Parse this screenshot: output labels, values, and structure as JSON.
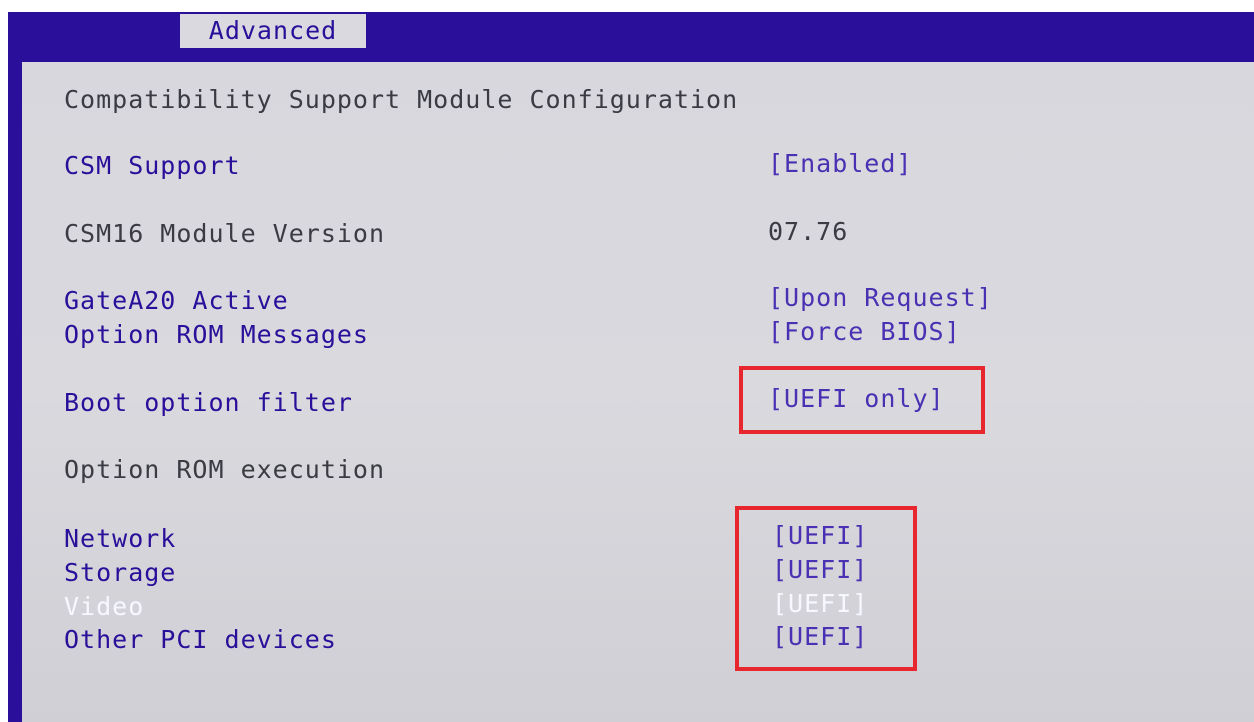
{
  "tabs": {
    "active": "Advanced"
  },
  "page": {
    "title": "Compatibility Support Module Configuration"
  },
  "settings": [
    {
      "label": "CSM Support",
      "value": "[Enabled]"
    },
    {
      "label": "CSM16 Module Version",
      "value": "07.76"
    },
    {
      "label": "GateA20 Active",
      "value": "[Upon Request]"
    },
    {
      "label": "Option ROM Messages",
      "value": "[Force BIOS]"
    },
    {
      "label": "Boot option filter",
      "value": "[UEFI only]"
    },
    {
      "label": "Option ROM execution"
    },
    {
      "label": "Network",
      "value": "[UEFI]"
    },
    {
      "label": "Storage",
      "value": "[UEFI]"
    },
    {
      "label": "Video",
      "value": "[UEFI]"
    },
    {
      "label": "Other PCI devices",
      "value": "[UEFI]"
    }
  ],
  "colors": {
    "bios_blue": "#2a0f9a",
    "panel_gray": "#d8d8de",
    "highlight_red": "#e8262d",
    "text_gray": "#3b3b44",
    "selected_white": "#f7f7ff"
  }
}
